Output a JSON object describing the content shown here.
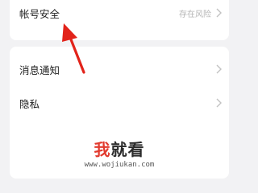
{
  "account_security": {
    "label": "帐号安全",
    "status": "存在风险",
    "chevron_icon": "chevron-right-icon"
  },
  "settings": [
    {
      "label": "消息通知",
      "chevron_icon": "chevron-right-icon"
    },
    {
      "label": "隐私",
      "chevron_icon": "chevron-right-icon"
    }
  ],
  "watermark": {
    "title_part1": "我",
    "title_part2": "就看",
    "url": "www.wojiukan.com"
  },
  "colors": {
    "background": "#f2f2f4",
    "card": "#ffffff",
    "arrow": "#e2231a",
    "status_text": "#b4b4b4",
    "watermark_red": "#e23b2f"
  }
}
